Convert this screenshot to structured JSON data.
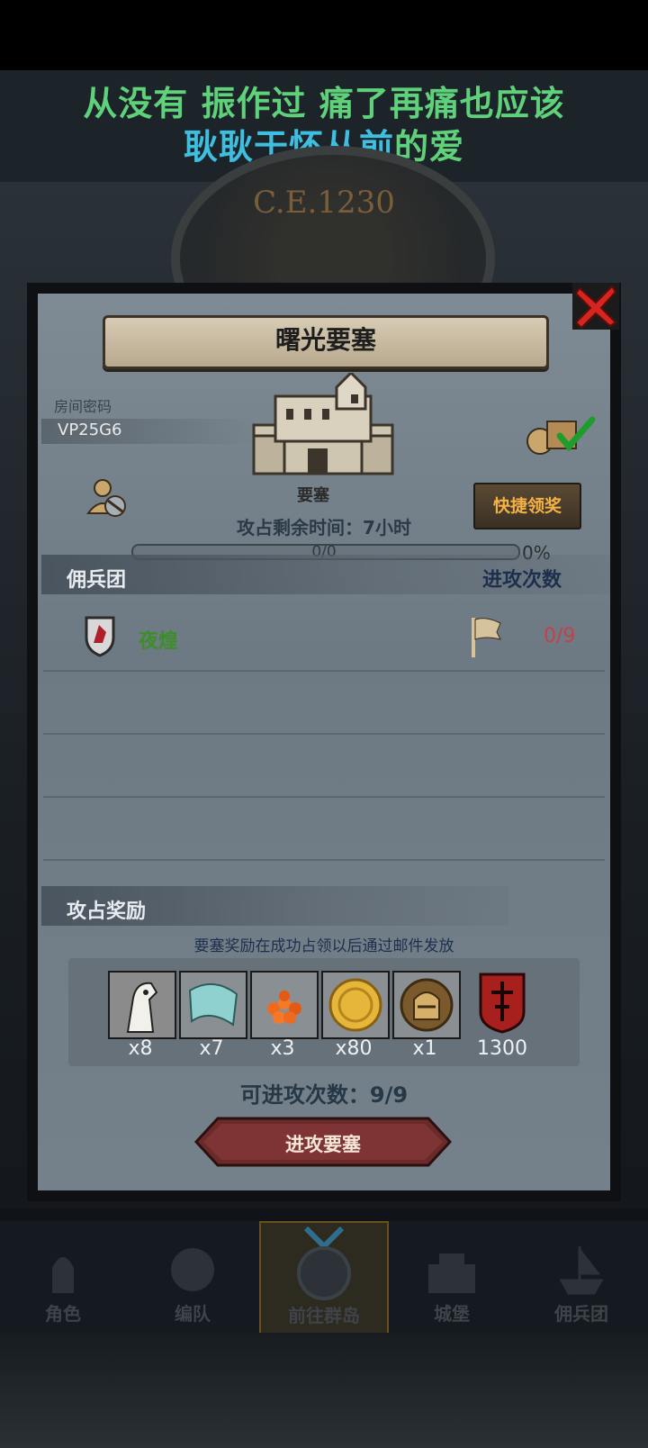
{
  "lyrics": {
    "line1": "从没有 振作过 痛了再痛也应该",
    "line2_a": "耿耿于怀从前",
    "line2_b": "的爱",
    "line1_color": "#5fd17b",
    "line2_a_color": "#3fbfe0",
    "line2_b_color": "#5fd17b"
  },
  "background": {
    "era_label": "C.E.1230"
  },
  "panel": {
    "title": "曙光要塞",
    "room_label": "房间密码",
    "room_code": "VP25G6",
    "building_label": "要塞",
    "quick_claim_label": "快捷领奖",
    "timer": "攻占剩余时间：7小时",
    "progress_text": "0/0",
    "progress_percent": "0%",
    "progress_fraction": 0
  },
  "mercenary_section": {
    "header_left": "佣兵团",
    "header_right": "进攻次数",
    "rows": [
      {
        "name": "夜煌",
        "attacks": "0/9"
      }
    ]
  },
  "rewards": {
    "header": "攻占奖励",
    "note": "要塞奖励在成功占领以后通过邮件发放",
    "items": [
      {
        "icon": "horse-icon",
        "qty": "x8"
      },
      {
        "icon": "cloth-icon",
        "qty": "x7"
      },
      {
        "icon": "caviar-icon",
        "qty": "x3"
      },
      {
        "icon": "gold-coin-icon",
        "qty": "x80"
      },
      {
        "icon": "knight-helmet-icon",
        "qty": "x1"
      },
      {
        "icon": "banner-icon",
        "qty": "1300"
      }
    ]
  },
  "attempts": "可进攻次数：9/9",
  "attack_button": "进攻要塞",
  "nav": {
    "items": [
      {
        "label": "角色"
      },
      {
        "label": "编队"
      },
      {
        "label": "前往群岛"
      },
      {
        "label": "城堡"
      },
      {
        "label": "佣兵团"
      }
    ]
  }
}
